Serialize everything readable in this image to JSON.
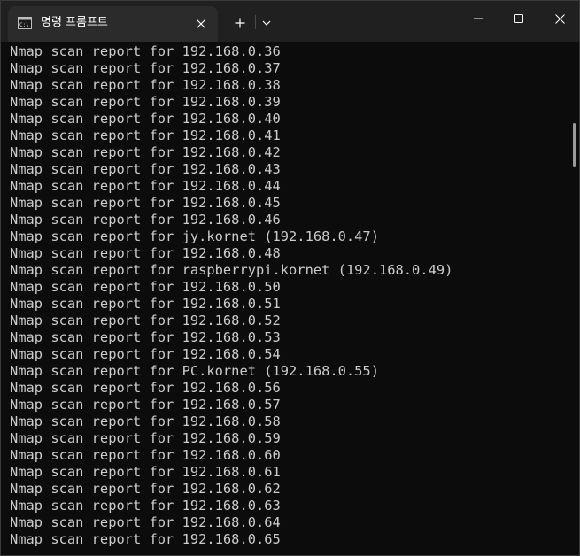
{
  "tab": {
    "title": "명령 프롬프트",
    "icon": "command-prompt-icon"
  },
  "titlebar": {
    "new_tab_icon": "plus-icon",
    "dropdown_icon": "chevron-down-icon",
    "minimize_icon": "minimize-icon",
    "maximize_icon": "maximize-icon",
    "close_icon": "close-icon"
  },
  "colors": {
    "background": "#0c0c0c",
    "titlebar": "#202020",
    "tab": "#2b2b2b",
    "text": "#cccccc"
  },
  "terminal": {
    "lines": [
      "Nmap scan report for 192.168.0.36",
      "Nmap scan report for 192.168.0.37",
      "Nmap scan report for 192.168.0.38",
      "Nmap scan report for 192.168.0.39",
      "Nmap scan report for 192.168.0.40",
      "Nmap scan report for 192.168.0.41",
      "Nmap scan report for 192.168.0.42",
      "Nmap scan report for 192.168.0.43",
      "Nmap scan report for 192.168.0.44",
      "Nmap scan report for 192.168.0.45",
      "Nmap scan report for 192.168.0.46",
      "Nmap scan report for jy.kornet (192.168.0.47)",
      "Nmap scan report for 192.168.0.48",
      "Nmap scan report for raspberrypi.kornet (192.168.0.49)",
      "Nmap scan report for 192.168.0.50",
      "Nmap scan report for 192.168.0.51",
      "Nmap scan report for 192.168.0.52",
      "Nmap scan report for 192.168.0.53",
      "Nmap scan report for 192.168.0.54",
      "Nmap scan report for PC.kornet (192.168.0.55)",
      "Nmap scan report for 192.168.0.56",
      "Nmap scan report for 192.168.0.57",
      "Nmap scan report for 192.168.0.58",
      "Nmap scan report for 192.168.0.59",
      "Nmap scan report for 192.168.0.60",
      "Nmap scan report for 192.168.0.61",
      "Nmap scan report for 192.168.0.62",
      "Nmap scan report for 192.168.0.63",
      "Nmap scan report for 192.168.0.64",
      "Nmap scan report for 192.168.0.65"
    ]
  }
}
